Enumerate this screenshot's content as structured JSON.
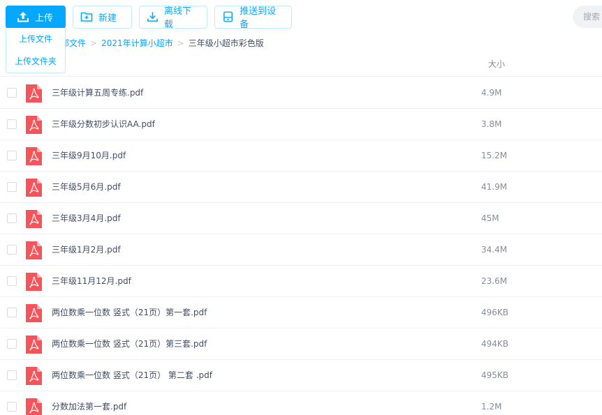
{
  "toolbar": {
    "upload_label": "上传",
    "new_label": "新建",
    "offline_label": "离线下载",
    "push_label": "推送到设备"
  },
  "upload_menu": {
    "items": [
      "上传文件",
      "上传文件夹"
    ]
  },
  "search": {
    "placeholder": "搜索"
  },
  "breadcrumb": {
    "items": [
      "部文件",
      "2021年计算小超市",
      "三年级小超市彩色版"
    ],
    "separator": ">"
  },
  "table": {
    "size_header": "大小"
  },
  "files": [
    {
      "name": "三年级计算五周专练.pdf",
      "size": "4.9M"
    },
    {
      "name": "三年级分数初步认识AA.pdf",
      "size": "3.8M"
    },
    {
      "name": "三年级9月10月.pdf",
      "size": "15.2M"
    },
    {
      "name": "三年级5月6月.pdf",
      "size": "41.9M"
    },
    {
      "name": "三年级3月4月.pdf",
      "size": "45M"
    },
    {
      "name": "三年级1月2月.pdf",
      "size": "34.4M"
    },
    {
      "name": "三年级11月12月.pdf",
      "size": "23.6M"
    },
    {
      "name": "两位数乘一位数 竖式（21页）第一套.pdf",
      "size": "496KB"
    },
    {
      "name": "两位数乘一位数 竖式（21页）第三套.pdf",
      "size": "494KB"
    },
    {
      "name": "两位数乘一位数 竖式（21页） 第二套 .pdf",
      "size": "495KB"
    },
    {
      "name": "分数加法第一套.pdf",
      "size": "1.2M"
    }
  ],
  "colors": {
    "accent": "#06a7ff",
    "pdf_red": "#f5555a"
  },
  "icons": {
    "upload": "upload-icon",
    "new": "new-folder-icon",
    "offline": "download-icon",
    "push": "device-icon",
    "file": "pdf-file-icon"
  }
}
